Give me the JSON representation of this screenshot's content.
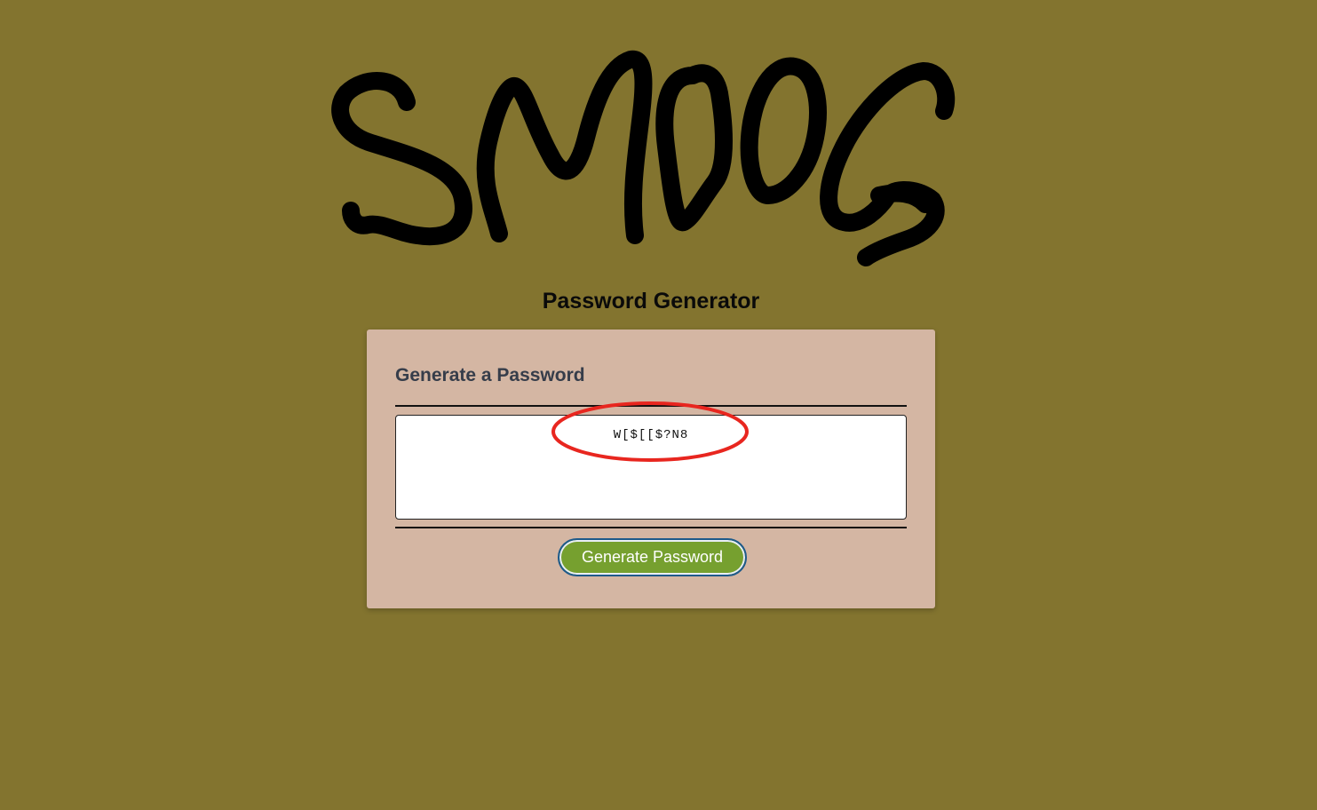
{
  "app": {
    "title": "Password Generator"
  },
  "card": {
    "header": "Generate a Password",
    "password_value": "W[$[[$?N8",
    "button_label": "Generate Password"
  },
  "colors": {
    "background": "#83742f",
    "card": "#d4b6a3",
    "button": "#76a02f",
    "annotation": "#e8261f"
  },
  "icons": {
    "logo": "hand-drawn-smoog-logo",
    "annotation": "red-highlight-ellipse"
  }
}
